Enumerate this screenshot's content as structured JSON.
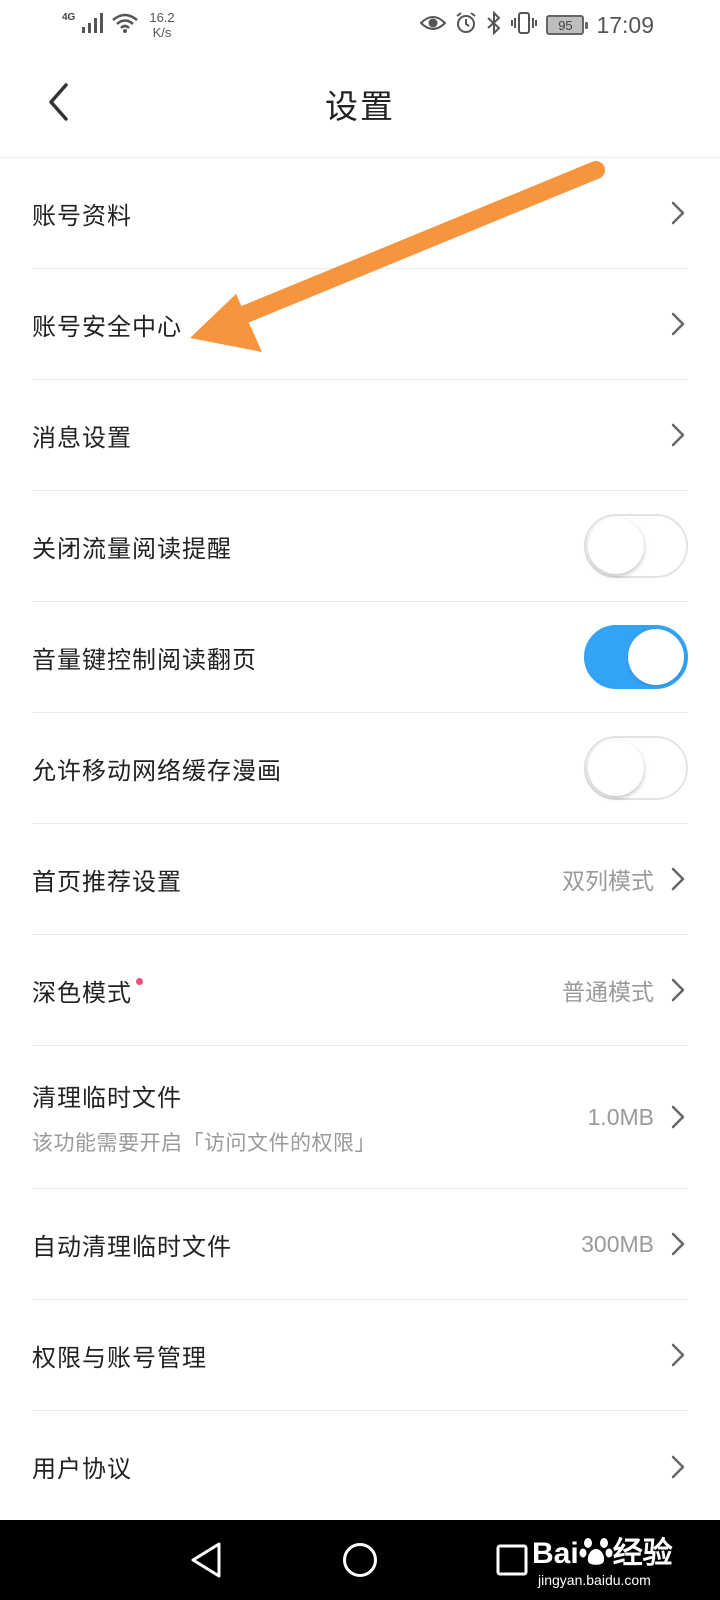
{
  "status_bar": {
    "network": "4G",
    "speed_value": "16.2",
    "speed_unit": "K/s",
    "battery": "95",
    "time": "17:09"
  },
  "header": {
    "title": "设置"
  },
  "settings": {
    "account_profile": {
      "label": "账号资料"
    },
    "account_security": {
      "label": "账号安全中心"
    },
    "message_settings": {
      "label": "消息设置"
    },
    "data_reading_reminder": {
      "label": "关闭流量阅读提醒",
      "enabled": false
    },
    "volume_key_page": {
      "label": "音量键控制阅读翻页",
      "enabled": true
    },
    "mobile_cache_comics": {
      "label": "允许移动网络缓存漫画",
      "enabled": false
    },
    "home_recommend": {
      "label": "首页推荐设置",
      "value": "双列模式"
    },
    "dark_mode": {
      "label": "深色模式",
      "value": "普通模式"
    },
    "clear_temp": {
      "label": "清理临时文件",
      "subtitle": "该功能需要开启「访问文件的权限」",
      "value": "1.0MB"
    },
    "auto_clear_temp": {
      "label": "自动清理临时文件",
      "value": "300MB"
    },
    "permissions": {
      "label": "权限与账号管理"
    },
    "user_agreement": {
      "label": "用户协议"
    }
  },
  "colors": {
    "toggle_on": "#33a3f4",
    "annotation_arrow": "#f7953f",
    "badge_dot": "#e5537a"
  },
  "watermark": {
    "logo_left": "Bai",
    "logo_right": "经验",
    "url": "jingyan.baidu.com"
  }
}
